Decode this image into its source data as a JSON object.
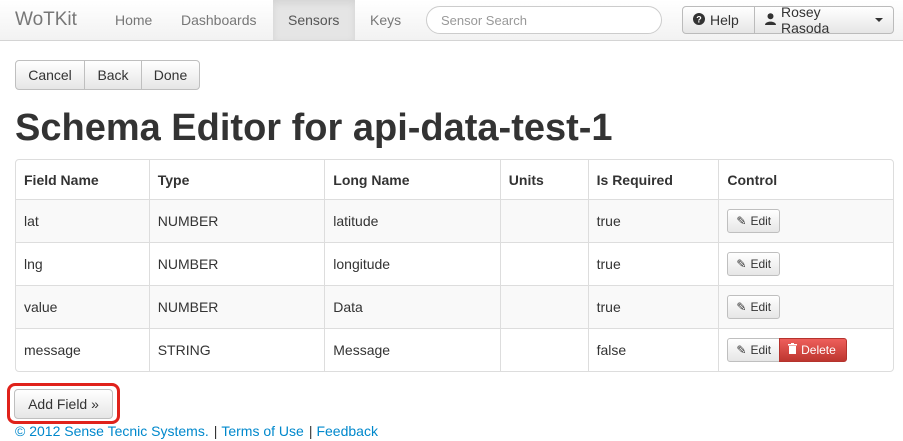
{
  "navbar": {
    "brand": "WoTKit",
    "items": [
      {
        "label": "Home",
        "active": false
      },
      {
        "label": "Dashboards",
        "active": false
      },
      {
        "label": "Sensors",
        "active": true
      },
      {
        "label": "Keys",
        "active": false
      }
    ],
    "search_placeholder": "Sensor Search",
    "help_label": "Help",
    "user_label": "Rosey Rasoda"
  },
  "actions": {
    "cancel": "Cancel",
    "back": "Back",
    "done": "Done"
  },
  "page": {
    "title": "Schema Editor for api-data-test-1"
  },
  "table": {
    "headers": [
      "Field Name",
      "Type",
      "Long Name",
      "Units",
      "Is Required",
      "Control"
    ],
    "rows": [
      {
        "field": "lat",
        "type": "NUMBER",
        "long_name": "latitude",
        "units": "",
        "required": "true",
        "edit": "Edit"
      },
      {
        "field": "lng",
        "type": "NUMBER",
        "long_name": "longitude",
        "units": "",
        "required": "true",
        "edit": "Edit"
      },
      {
        "field": "value",
        "type": "NUMBER",
        "long_name": "Data",
        "units": "",
        "required": "true",
        "edit": "Edit"
      },
      {
        "field": "message",
        "type": "STRING",
        "long_name": "Message",
        "units": "",
        "required": "false",
        "edit": "Edit",
        "delete": "Delete"
      }
    ]
  },
  "add_field_label": "Add Field »",
  "footer": {
    "copyright": "© 2012 Sense Tecnic Systems.",
    "terms": "Terms of Use",
    "feedback": "Feedback"
  },
  "colors": {
    "highlight": "#e0221b",
    "delete": "#da4f49",
    "link": "#0088cc"
  }
}
